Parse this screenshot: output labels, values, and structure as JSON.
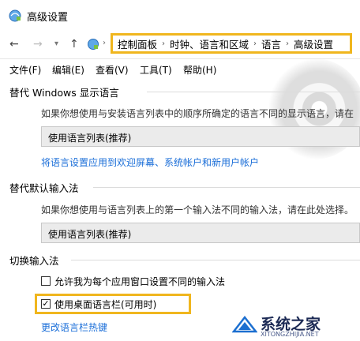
{
  "window": {
    "title": "高级设置"
  },
  "address": {
    "breadcrumbs": [
      "控制面板",
      "时钟、语言和区域",
      "语言",
      "高级设置"
    ],
    "sep_glyph": "›"
  },
  "menu": {
    "items": [
      "文件(F)",
      "编辑(E)",
      "查看(V)",
      "工具(T)",
      "帮助(H)"
    ]
  },
  "display_language": {
    "title": "替代 Windows 显示语言",
    "description": "如果你想使用与安装语言列表中的顺序所确定的语言不同的显示语言，请在",
    "dropdown_value": "使用语言列表(推荐)",
    "link": "将语言设置应用到欢迎屏幕、系统帐户和新用户帐户"
  },
  "default_input": {
    "title": "替代默认输入法",
    "description": "如果你想使用与语言列表上的第一个输入法不同的输入法，请在此处选择。",
    "dropdown_value": "使用语言列表(推荐)"
  },
  "switch_input": {
    "title": "切换输入法",
    "options": [
      {
        "label": "允许我为每个应用窗口设置不同的输入法",
        "checked": false
      },
      {
        "label": "使用桌面语言栏(可用时)",
        "checked": true
      }
    ],
    "link": "更改语言栏热键"
  },
  "watermark": {
    "text": "系统之家",
    "sub": "XITONGZHIJIA.NET"
  },
  "colors": {
    "highlight": "#f0b61e",
    "link": "#1a6ed8"
  }
}
